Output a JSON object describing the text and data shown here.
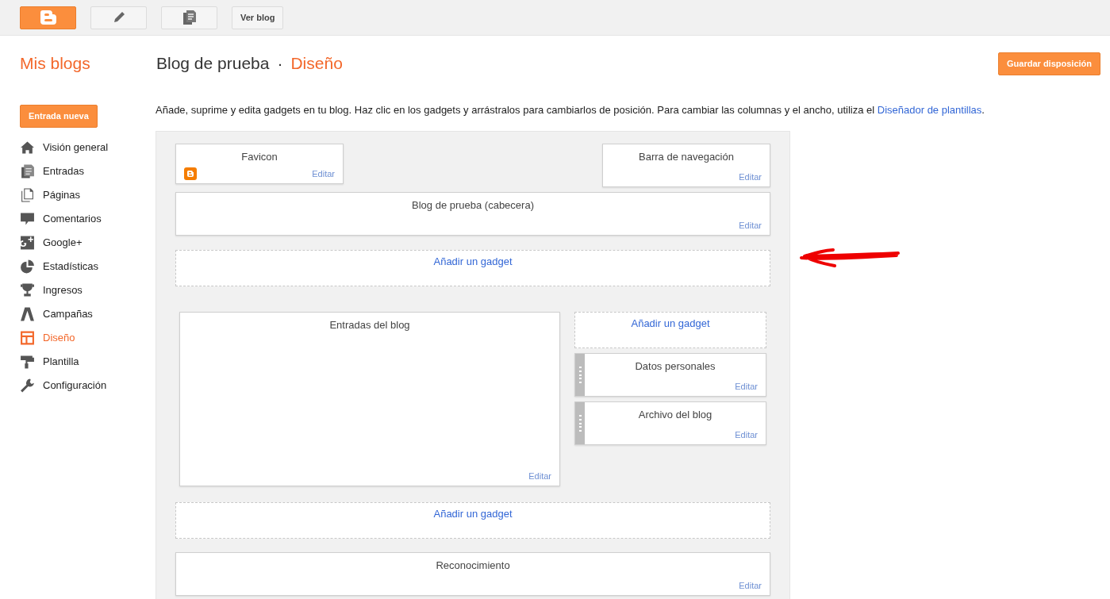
{
  "toolbar": {
    "view_blog": "Ver blog"
  },
  "header": {
    "my_blogs": "Mis blogs",
    "blog_name": "Blog de prueba",
    "separator": "·",
    "page": "Diseño",
    "save": "Guardar disposición"
  },
  "sidebar": {
    "new_post": "Entrada nueva",
    "items": [
      {
        "label": "Visión general",
        "kind": "home",
        "selected": false
      },
      {
        "label": "Entradas",
        "kind": "posts",
        "selected": false
      },
      {
        "label": "Páginas",
        "kind": "pages",
        "selected": false
      },
      {
        "label": "Comentarios",
        "kind": "comments",
        "selected": false
      },
      {
        "label": "Google+",
        "kind": "gplus",
        "selected": false
      },
      {
        "label": "Estadísticas",
        "kind": "stats",
        "selected": false
      },
      {
        "label": "Ingresos",
        "kind": "trophy",
        "selected": false
      },
      {
        "label": "Campañas",
        "kind": "campaigns",
        "selected": false
      },
      {
        "label": "Diseño",
        "kind": "layout",
        "selected": true
      },
      {
        "label": "Plantilla",
        "kind": "roller",
        "selected": false
      },
      {
        "label": "Configuración",
        "kind": "wrench",
        "selected": false
      }
    ]
  },
  "intro": {
    "text": "Añade, suprime y edita gadgets en tu blog. Haz clic en los gadgets y arrástralos para cambiarlos de posición. Para cambiar las columnas y el ancho, utiliza el ",
    "link": "Diseñador de plantillas",
    "end": "."
  },
  "layout": {
    "top_row": [
      {
        "kind": "favicon",
        "title": "Favicon",
        "edit": "Editar"
      },
      {
        "kind": "gadget",
        "title": "Barra de navegación",
        "edit": "Editar"
      }
    ],
    "header": [
      {
        "kind": "gadget",
        "title": "Blog de prueba (cabecera)",
        "edit": "Editar"
      },
      {
        "kind": "add",
        "title": "Añadir un gadget"
      }
    ],
    "main": [
      {
        "kind": "tall",
        "title": "Entradas del blog",
        "edit": "Editar"
      }
    ],
    "side": [
      {
        "kind": "add",
        "title": "Añadir un gadget"
      },
      {
        "kind": "draggable",
        "title": "Datos personales",
        "edit": "Editar"
      },
      {
        "kind": "draggable",
        "title": "Archivo del blog",
        "edit": "Editar"
      }
    ],
    "footer": [
      {
        "kind": "add",
        "title": "Añadir un gadget"
      },
      {
        "kind": "gadget",
        "title": "Reconocimiento",
        "edit": "Editar"
      }
    ]
  }
}
